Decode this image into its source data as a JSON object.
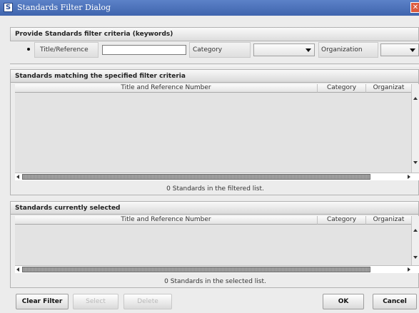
{
  "window": {
    "title": "Standards Filter Dialog",
    "app_icon": "S",
    "close_glyph": "✕"
  },
  "filter_panel": {
    "header": "Provide Standards filter criteria (keywords)",
    "title_label": "Title/Reference",
    "title_value": "",
    "category_label": "Category",
    "category_value": "",
    "organization_label": "Organization",
    "organization_value": ""
  },
  "filtered_panel": {
    "header": "Standards matching the specified filter criteria",
    "columns": [
      "Title and Reference Number",
      "Category",
      "Organizat"
    ],
    "rows": [],
    "status": "0 Standards in the filtered list."
  },
  "selected_panel": {
    "header": "Standards currently selected",
    "columns": [
      "Title and Reference Number",
      "Category",
      "Organizat"
    ],
    "rows": [],
    "status": "0 Standards in the selected list."
  },
  "buttons": {
    "clear_filter": "Clear Filter",
    "select": "Select",
    "delete": "Delete",
    "ok": "OK",
    "cancel": "Cancel"
  },
  "icons": [
    "app-logo-icon",
    "close-icon",
    "bullet-icon",
    "chevron-down-icon",
    "scroll-up-icon",
    "scroll-down-icon",
    "scroll-left-icon",
    "scroll-right-icon"
  ],
  "colors": {
    "titlebar": "#4a6fb8",
    "close_button": "#dd5b3e",
    "background": "#ececec"
  }
}
